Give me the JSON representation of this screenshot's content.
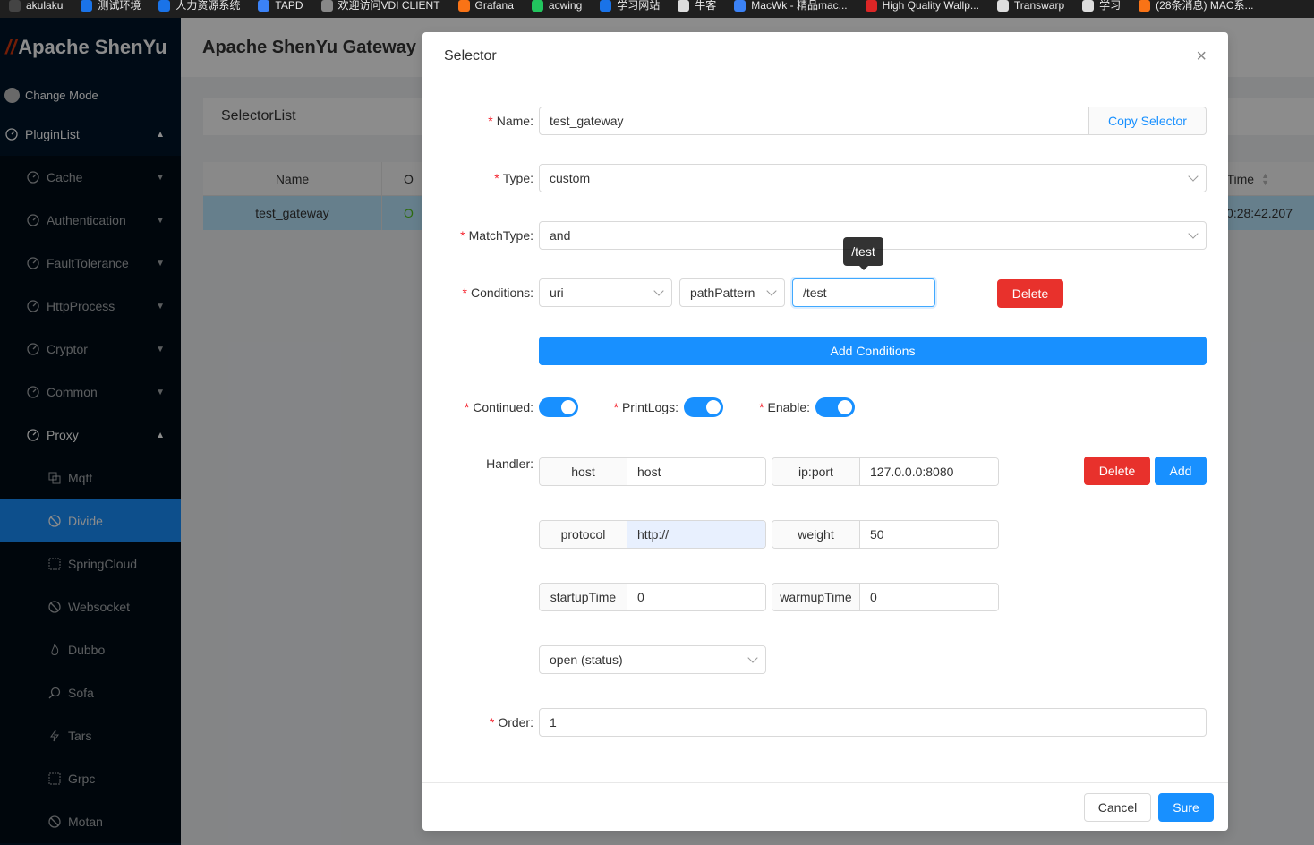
{
  "bookmarks": [
    {
      "label": "akulaku",
      "color": "#444444"
    },
    {
      "label": "测试环境",
      "color": "#1a73e8"
    },
    {
      "label": "人力资源系统",
      "color": "#1a73e8"
    },
    {
      "label": "TAPD",
      "color": "#3b82f6"
    },
    {
      "label": "欢迎访问VDI CLIENT",
      "color": "#888888"
    },
    {
      "label": "Grafana",
      "color": "#f97316"
    },
    {
      "label": "acwing",
      "color": "#22c55e"
    },
    {
      "label": "学习网站",
      "color": "#1a73e8"
    },
    {
      "label": "牛客",
      "color": "#dddddd"
    },
    {
      "label": "MacWk - 精品mac...",
      "color": "#3b82f6"
    },
    {
      "label": "High Quality Wallp...",
      "color": "#dc2626"
    },
    {
      "label": "Transwarp",
      "color": "#dddddd"
    },
    {
      "label": "学习",
      "color": "#dddddd"
    },
    {
      "label": "(28条消息) MAC系...",
      "color": "#f97316"
    }
  ],
  "sidebar": {
    "logo": "Apache ShenYu",
    "change_mode": "Change Mode",
    "plugin_list": "PluginList",
    "groups": [
      {
        "label": "Cache"
      },
      {
        "label": "Authentication"
      },
      {
        "label": "FaultTolerance"
      },
      {
        "label": "HttpProcess"
      },
      {
        "label": "Cryptor"
      },
      {
        "label": "Common"
      }
    ],
    "proxy": "Proxy",
    "proxy_items": [
      {
        "label": "Mqtt",
        "icon": "copy-icon"
      },
      {
        "label": "Divide",
        "icon": "stop-icon"
      },
      {
        "label": "SpringCloud",
        "icon": "grid-icon"
      },
      {
        "label": "Websocket",
        "icon": "stop-icon"
      },
      {
        "label": "Dubbo",
        "icon": "fire-icon"
      },
      {
        "label": "Sofa",
        "icon": "search-icon"
      },
      {
        "label": "Tars",
        "icon": "thunderbolt-icon"
      },
      {
        "label": "Grpc",
        "icon": "grid-icon"
      },
      {
        "label": "Motan",
        "icon": "stop-icon"
      }
    ]
  },
  "header": {
    "title": "Apache ShenYu Gateway M"
  },
  "page": {
    "selector_list": "SelectorList",
    "table": {
      "col_name": "Name",
      "col_o": "O",
      "col_time": "Time",
      "row_name": "test_gateway",
      "row_o": "O",
      "row_time": "0:28:42.207"
    }
  },
  "modal": {
    "title": "Selector",
    "name_label": "Name",
    "name_value": "test_gateway",
    "copy_selector": "Copy Selector",
    "type_label": "Type",
    "type_value": "custom",
    "matchtype_label": "MatchType",
    "matchtype_value": "and",
    "conditions_label": "Conditions",
    "cond_param": "uri",
    "cond_operator": "pathPattern",
    "cond_value": "/test",
    "tooltip": "/test",
    "delete": "Delete",
    "add_conditions": "Add Conditions",
    "continued_label": "Continued",
    "printlogs_label": "PrintLogs",
    "enable_label": "Enable",
    "handler_label": "Handler:",
    "host_label": "host",
    "host_placeholder": "host",
    "ipport_label": "ip:port",
    "ipport_value": "127.0.0.0:8080",
    "protocol_label": "protocol",
    "protocol_value": "http://",
    "weight_label": "weight",
    "weight_value": "50",
    "startuptime_label": "startupTime",
    "startuptime_value": "0",
    "warmuptime_label": "warmupTime",
    "warmuptime_value": "0",
    "status_value": "open (status)",
    "handler_delete": "Delete",
    "handler_add": "Add",
    "order_label": "Order",
    "order_value": "1",
    "cancel": "Cancel",
    "sure": "Sure",
    "required_mark": "*",
    "colon": ":",
    "close_icon": "×"
  }
}
